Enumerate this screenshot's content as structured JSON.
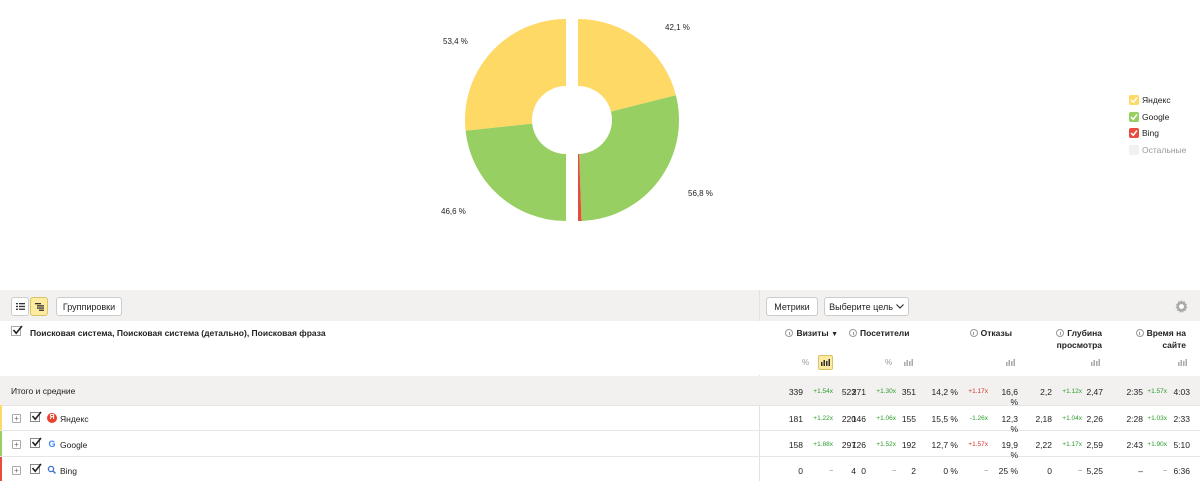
{
  "chart_data": {
    "type": "pie",
    "inner": [
      {
        "name": "Яндекс",
        "value": 53.4,
        "color": "#fed966"
      },
      {
        "name": "Google",
        "value": 46.6,
        "color": "#98cf63"
      },
      {
        "name": "Bing",
        "value": 0,
        "color": "#e84c3c"
      }
    ],
    "outer": [
      {
        "name": "Яндекс",
        "value": 42.1,
        "color": "#fed966"
      },
      {
        "name": "Google",
        "value": 56.8,
        "color": "#98cf63"
      },
      {
        "name": "Bing",
        "value": 1.1,
        "color": "#e84c3c"
      }
    ],
    "labels": [
      "53,4 %",
      "46,6 %",
      "42,1 %",
      "56,8 %"
    ]
  },
  "legend": [
    {
      "label": "Яндекс",
      "color": "#fed966",
      "checked": true
    },
    {
      "label": "Google",
      "color": "#98cf63",
      "checked": true
    },
    {
      "label": "Bing",
      "color": "#e84c3c",
      "checked": true
    },
    {
      "label": "Остальные",
      "color": "#f2f1f0",
      "checked": false
    }
  ],
  "toolbar": {
    "groupings": "Группировки",
    "metrics": "Метрики",
    "goal": "Выберите цель"
  },
  "header": {
    "dimensions": "Поисковая система, Поисковая система (детально), Поисковая фраза",
    "visits": "Визиты",
    "visits_sort": "▼",
    "visitors": "Посетители",
    "bounces": "Отказы",
    "depth_line1": "Глубина",
    "depth_line2": "просмотра",
    "time_line1": "Время на",
    "time_line2": "сайте",
    "pct_icon": "%"
  },
  "rows": [
    {
      "label": "Итого и средние",
      "visits": [
        "339",
        "+1.54x",
        "523"
      ],
      "visitors": [
        "271",
        "+1.30x",
        "351"
      ],
      "bounces": [
        "14,2 %",
        "+1.17x",
        "16,6 %"
      ],
      "depth": [
        "2,2",
        "+1.12x",
        "2,47"
      ],
      "time": [
        "2:35",
        "+1.57x",
        "4:03"
      ]
    },
    {
      "label": "Яндекс",
      "color": "#fed966",
      "visits": [
        "181",
        "+1.22x",
        "220"
      ],
      "visitors": [
        "146",
        "+1.06x",
        "155"
      ],
      "bounces": [
        "15,5 %",
        "-1.26x",
        "12,3 %"
      ],
      "depth": [
        "2,18",
        "+1.04x",
        "2,26"
      ],
      "time": [
        "2:28",
        "+1.03x",
        "2:33"
      ]
    },
    {
      "label": "Google",
      "color": "#98cf63",
      "visits": [
        "158",
        "+1.88x",
        "297"
      ],
      "visitors": [
        "126",
        "+1.52x",
        "192"
      ],
      "bounces": [
        "12,7 %",
        "+1.57x",
        "19,9 %"
      ],
      "depth": [
        "2,22",
        "+1.17x",
        "2,59"
      ],
      "time": [
        "2:43",
        "+1.90x",
        "5:10"
      ]
    },
    {
      "label": "Bing",
      "color": "#e84c3c",
      "visits": [
        "0",
        "–",
        "4"
      ],
      "visitors": [
        "0",
        "–",
        "2"
      ],
      "bounces": [
        "0 %",
        "–",
        "25 %"
      ],
      "depth": [
        "0",
        "–",
        "5,25"
      ],
      "time": [
        "–",
        "–",
        "6:36"
      ]
    }
  ]
}
